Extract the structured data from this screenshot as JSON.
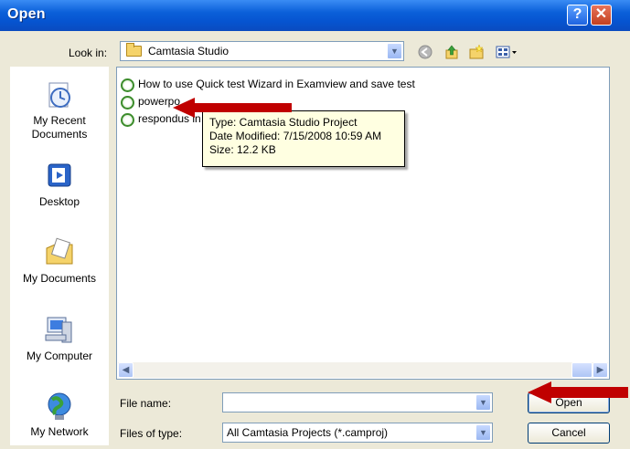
{
  "window": {
    "title": "Open"
  },
  "toolbar": {
    "look_in_label": "Look in:",
    "look_in_value": "Camtasia Studio",
    "back_icon": "back-icon",
    "up_icon": "up-folder-icon",
    "new_folder_icon": "new-folder-icon",
    "views_icon": "views-menu-icon"
  },
  "places": [
    {
      "label": "My Recent Documents",
      "icon": "recent-documents-icon"
    },
    {
      "label": "Desktop",
      "icon": "desktop-icon"
    },
    {
      "label": "My Documents",
      "icon": "my-documents-icon"
    },
    {
      "label": "My Computer",
      "icon": "my-computer-icon"
    },
    {
      "label": "My Network",
      "icon": "my-network-icon"
    }
  ],
  "files": [
    {
      "name": "How to use Quick test Wizard in Examview and save test"
    },
    {
      "name": "powerpo"
    },
    {
      "name": "respondus in"
    }
  ],
  "tooltip": {
    "type": "Type: Camtasia Studio Project",
    "modified": "Date Modified: 7/15/2008 10:59 AM",
    "size": "Size: 12.2 KB"
  },
  "form": {
    "file_name_label": "File name:",
    "file_name_value": "",
    "files_of_type_label": "Files of type:",
    "files_of_type_value": "All Camtasia Projects (*.camproj)"
  },
  "buttons": {
    "open": "Open",
    "cancel": "Cancel"
  },
  "colors": {
    "titlebar": "#0654d0",
    "arrow": "#c00000",
    "tooltip_bg": "#ffffe1"
  }
}
